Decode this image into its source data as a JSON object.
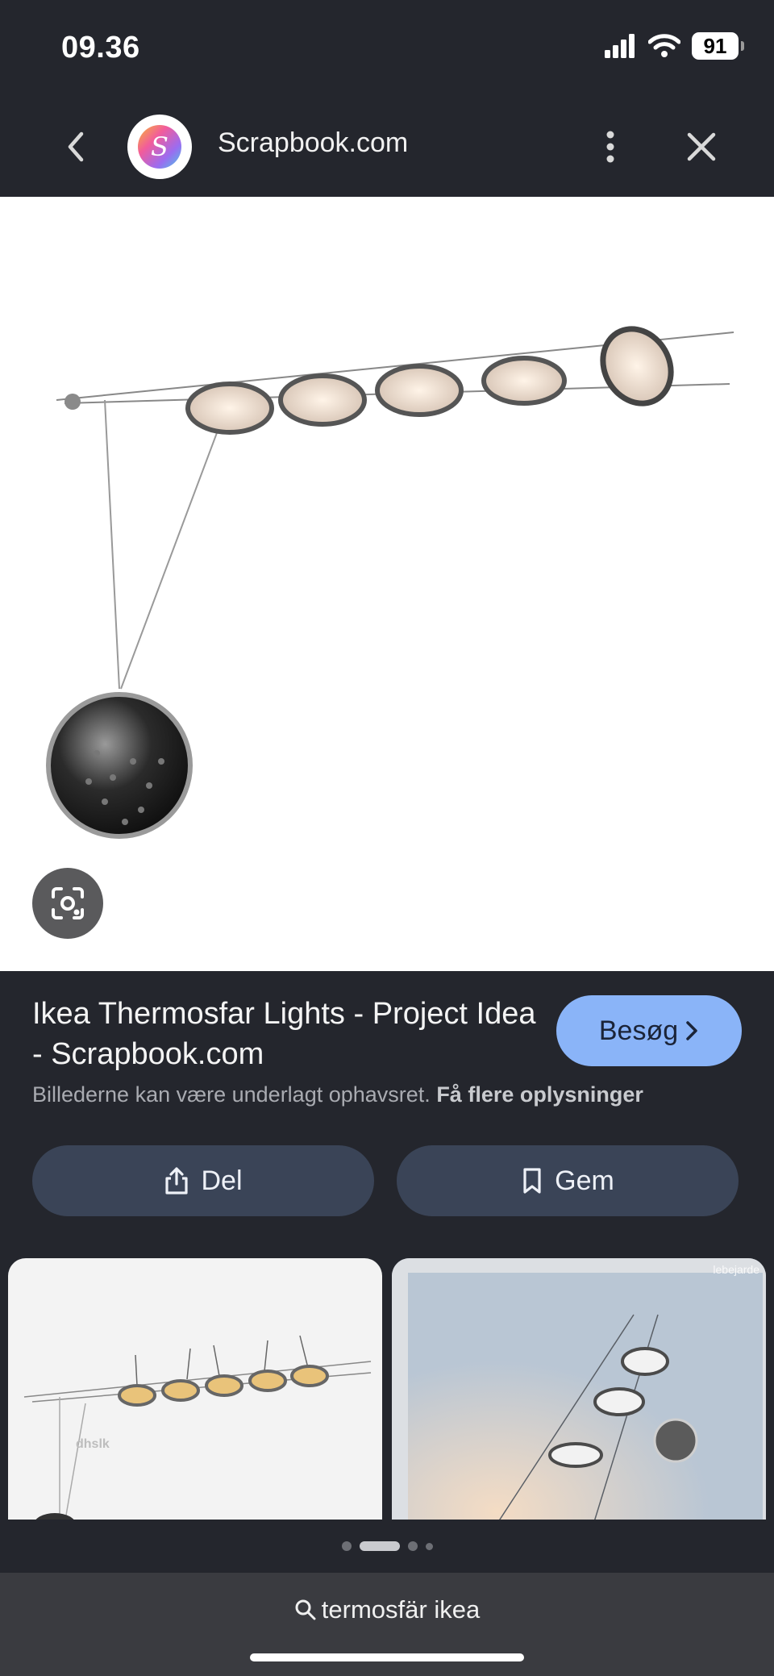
{
  "status_bar": {
    "time": "09.36",
    "battery": "91"
  },
  "top_bar": {
    "site_name": "Scrapbook.com"
  },
  "result": {
    "title": "Ikea Thermosfar Lights - Project Idea - Scrapbook.com",
    "visit_label": "Besøg",
    "copyright_text": "Billederne kan være underlagt ophavsret.",
    "more_info_link": "Få flere oplysninger",
    "share_label": "Del",
    "save_label": "Gem"
  },
  "thumbnails": [
    {
      "watermark": "dhslk"
    },
    {
      "watermark": "lebejarde"
    }
  ],
  "pager": {
    "count": 4,
    "active_index": 1
  },
  "search": {
    "query": "termosfär ikea"
  },
  "colors": {
    "background": "#24262d",
    "accent": "#8ab4f8",
    "action_button": "#3a4457"
  }
}
